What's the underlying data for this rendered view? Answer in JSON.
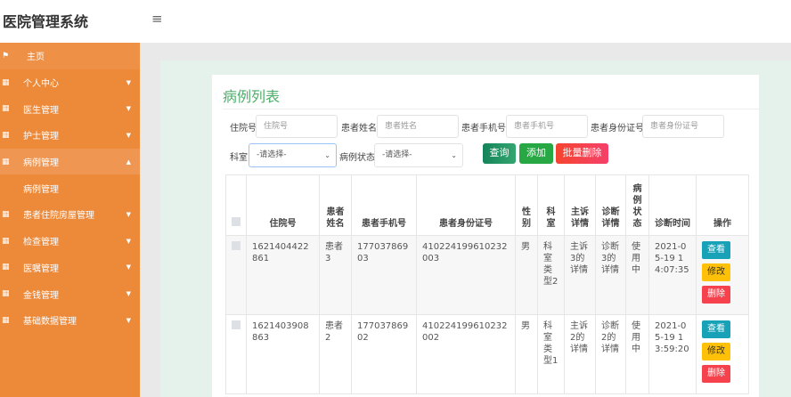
{
  "app": {
    "title": "医院管理系统",
    "menu_icon": "hamburger-icon"
  },
  "sidebar": {
    "items": [
      {
        "label": "主页",
        "icon": "flag-icon"
      },
      {
        "label": "个人中心",
        "icon": "grid-icon"
      },
      {
        "label": "医生管理",
        "icon": "grid-icon"
      },
      {
        "label": "护士管理",
        "icon": "grid-icon"
      },
      {
        "label": "病例管理",
        "icon": "grid-icon",
        "expanded": true
      },
      {
        "label": "病例管理",
        "sub": true
      },
      {
        "label": "患者住院房屋管理",
        "icon": "grid-icon"
      },
      {
        "label": "检查管理",
        "icon": "grid-icon"
      },
      {
        "label": "医嘱管理",
        "icon": "grid-icon"
      },
      {
        "label": "金钱管理",
        "icon": "grid-icon"
      },
      {
        "label": "基础数据管理",
        "icon": "grid-icon"
      }
    ]
  },
  "page": {
    "title": "病例列表"
  },
  "search": {
    "f1_label": "住院号",
    "f1_placeholder": "住院号",
    "f2_label": "患者姓名",
    "f2_placeholder": "患者姓名",
    "f3_label": "患者手机号",
    "f3_placeholder": "患者手机号",
    "f4_label": "患者身份证号",
    "f4_placeholder": "患者身份证号",
    "dept_label": "科室",
    "dept_value": "-请选择-",
    "status_label": "病例状态",
    "status_value": "-请选择-",
    "query": "查询",
    "add": "添加",
    "batch_delete": "批量删除"
  },
  "table": {
    "headers": [
      "住院号",
      "患者姓名",
      "患者手机号",
      "患者身份证号",
      "性别",
      "科室",
      "主诉详情",
      "诊断详情",
      "病例状态",
      "诊断时间",
      "操作"
    ],
    "rows": [
      [
        "1621404422861",
        "患者3",
        "17703786903",
        "410224199610232003",
        "男",
        "科室类型2",
        "主诉3的详情",
        "诊断3的详情",
        "使用中",
        "2021-05-19 14:07:35"
      ],
      [
        "1621403908863",
        "患者2",
        "17703786902",
        "410224199610232002",
        "男",
        "科室类型1",
        "主诉2的详情",
        "诊断2的详情",
        "使用中",
        "2021-05-19 13:59:20"
      ]
    ],
    "actions": {
      "view": "查看",
      "edit": "修改",
      "delete": "删除"
    }
  },
  "colors": {
    "sidebar": "#ed8a3a",
    "title": "#4cae6a",
    "query": "#1a9160",
    "add": "#28a745",
    "delete": "#f5424d",
    "view": "#17a2b8",
    "edit": "#ffc107"
  }
}
